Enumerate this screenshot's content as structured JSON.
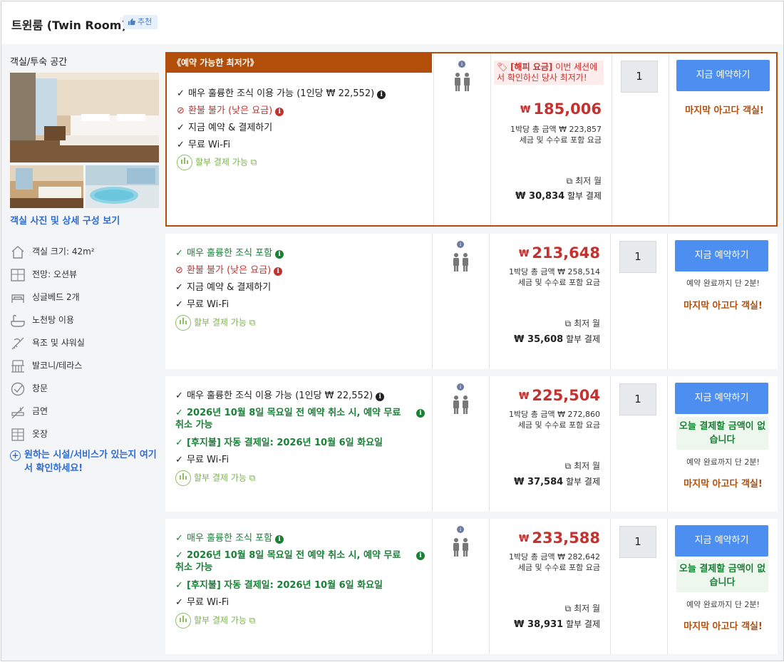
{
  "header": {
    "title": "트윈룸 (Twin Room)",
    "badge": "추천"
  },
  "left": {
    "section_label": "객실/투숙 공간",
    "view_link": "객실 사진 및 상세 구성 보기",
    "amenities": [
      {
        "icon": "house-icon",
        "label": "객실 크기: 42m²"
      },
      {
        "icon": "window-view-icon",
        "label": "전망: 오션뷰"
      },
      {
        "icon": "bed-icon",
        "label": "싱글베드 2개"
      },
      {
        "icon": "bath-icon",
        "label": "노천탕 이용"
      },
      {
        "icon": "shower-icon",
        "label": "욕조 및 샤워실"
      },
      {
        "icon": "balcony-icon",
        "label": "발코니/테라스"
      },
      {
        "icon": "window-check-icon",
        "label": "창문"
      },
      {
        "icon": "no-smoking-icon",
        "label": "금연"
      },
      {
        "icon": "wardrobe-icon",
        "label": "옷장"
      }
    ],
    "facility_link": "원하는 시설/서비스가 있는지 여기서 확인하세요!"
  },
  "offers": [
    {
      "deal_banner": "《예약 가능한 최저가》",
      "features": [
        {
          "style": "black",
          "mark": "✓",
          "text": "매우 훌륭한 조식 이용 가능 (1인당 ₩ 22,552)",
          "info": "k"
        },
        {
          "style": "red",
          "mark": "⊘",
          "text": "환불 불가 (낮은 요금)",
          "info": "r"
        },
        {
          "style": "black",
          "mark": "✓",
          "text": "지금 예약 & 결제하기"
        },
        {
          "style": "black",
          "mark": "✓",
          "text": "무료 Wi-Fi"
        }
      ],
      "installment": "할부 결제 가능",
      "happy_tag": "[해피 요금]",
      "happy_text": "이번 세션에서 확인하신 당사 최저가!",
      "currency": "₩",
      "price": "185,006",
      "total_line": "1박당 총 금액 ₩ 223,857",
      "tax_line": "세금 및 수수료 포함 요금",
      "monthly_label": "최저 월",
      "monthly_amount": "₩ 30,834",
      "monthly_suffix": "할부 결제",
      "qty": "1",
      "book": "지금 예약하기",
      "last_room": "마지막 아고다 객실!"
    },
    {
      "features": [
        {
          "style": "green",
          "mark": "✓",
          "text": "매우 훌륭한 조식 포함",
          "info": "g"
        },
        {
          "style": "red",
          "mark": "⊘",
          "text": "환불 불가 (낮은 요금)",
          "info": "r"
        },
        {
          "style": "black",
          "mark": "✓",
          "text": "지금 예약 & 결제하기"
        },
        {
          "style": "black",
          "mark": "✓",
          "text": "무료 Wi-Fi"
        }
      ],
      "installment": "할부 결제 가능",
      "currency": "₩",
      "price": "213,648",
      "total_line": "1박당 총 금액 ₩ 258,514",
      "tax_line": "세금 및 수수료 포함 요금",
      "monthly_label": "최저 월",
      "monthly_amount": "₩ 35,608",
      "monthly_suffix": "할부 결제",
      "qty": "1",
      "book": "지금 예약하기",
      "mins_left": "예약 완료까지 단 2분!",
      "last_room": "마지막 아고다 객실!"
    },
    {
      "features": [
        {
          "style": "black",
          "mark": "✓",
          "text": "매우 훌륭한 조식 이용 가능 (1인당 ₩ 22,552)",
          "info": "k"
        },
        {
          "style": "green bold",
          "mark": "✓",
          "text": "2026년 10월 8일 목요일 전 예약 취소 시, 예약 무료 취소 가능",
          "info": "g"
        },
        {
          "style": "green bold",
          "mark": "✓",
          "text": "[후지불] 자동 결제일: 2026년 10월 6일 화요일"
        },
        {
          "style": "black",
          "mark": "✓",
          "text": "무료 Wi-Fi"
        }
      ],
      "installment": "할부 결제 가능",
      "currency": "₩",
      "price": "225,504",
      "total_line": "1박당 총 금액 ₩ 272,860",
      "tax_line": "세금 및 수수료 포함 요금",
      "monthly_label": "최저 월",
      "monthly_amount": "₩ 37,584",
      "monthly_suffix": "할부 결제",
      "qty": "1",
      "book": "지금 예약하기",
      "no_pay": "오늘 결제할 금액이 없습니다",
      "mins_left": "예약 완료까지 단 2분!",
      "last_room": "마지막 아고다 객실!"
    },
    {
      "features": [
        {
          "style": "green",
          "mark": "✓",
          "text": "매우 훌륭한 조식 포함",
          "info": "g"
        },
        {
          "style": "green bold",
          "mark": "✓",
          "text": "2026년 10월 8일 목요일 전 예약 취소 시, 예약 무료 취소 가능",
          "info": "g"
        },
        {
          "style": "green bold",
          "mark": "✓",
          "text": "[후지불] 자동 결제일: 2026년 10월 6일 화요일"
        },
        {
          "style": "black",
          "mark": "✓",
          "text": "무료 Wi-Fi"
        }
      ],
      "installment": "할부 결제 가능",
      "currency": "₩",
      "price": "233,588",
      "total_line": "1박당 총 금액 ₩ 282,642",
      "tax_line": "세금 및 수수료 포함 요금",
      "monthly_label": "최저 월",
      "monthly_amount": "₩ 38,931",
      "monthly_suffix": "할부 결제",
      "qty": "1",
      "book": "지금 예약하기",
      "no_pay": "오늘 결제할 금액이 없습니다",
      "mins_left": "예약 완료까지 단 2분!",
      "last_room": "마지막 아고다 객실!"
    }
  ],
  "colors": {
    "brand_orange": "#b34d0a",
    "price_red": "#c4322f",
    "button_blue": "#4d8ff0",
    "green": "#1a7f37",
    "link_blue": "#2e6bd2"
  }
}
